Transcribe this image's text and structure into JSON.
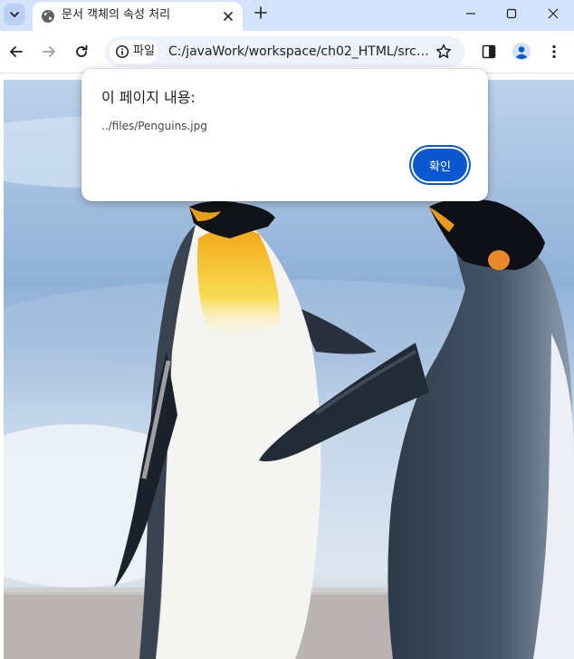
{
  "tab": {
    "title": "문서 객체의 속성 처리",
    "favicon": "globe-icon"
  },
  "toolbar": {
    "chip_label": "파일",
    "url": "C:/javaWork/workspace/ch02_HTML/src/mai..."
  },
  "dialog": {
    "title": "이 페이지 내용:",
    "message": "../files/Penguins.jpg",
    "ok_label": "확인"
  },
  "colors": {
    "tabstrip": "#d3e3fd",
    "omnibox": "#eef2fa",
    "accent": "#0b57d0"
  }
}
